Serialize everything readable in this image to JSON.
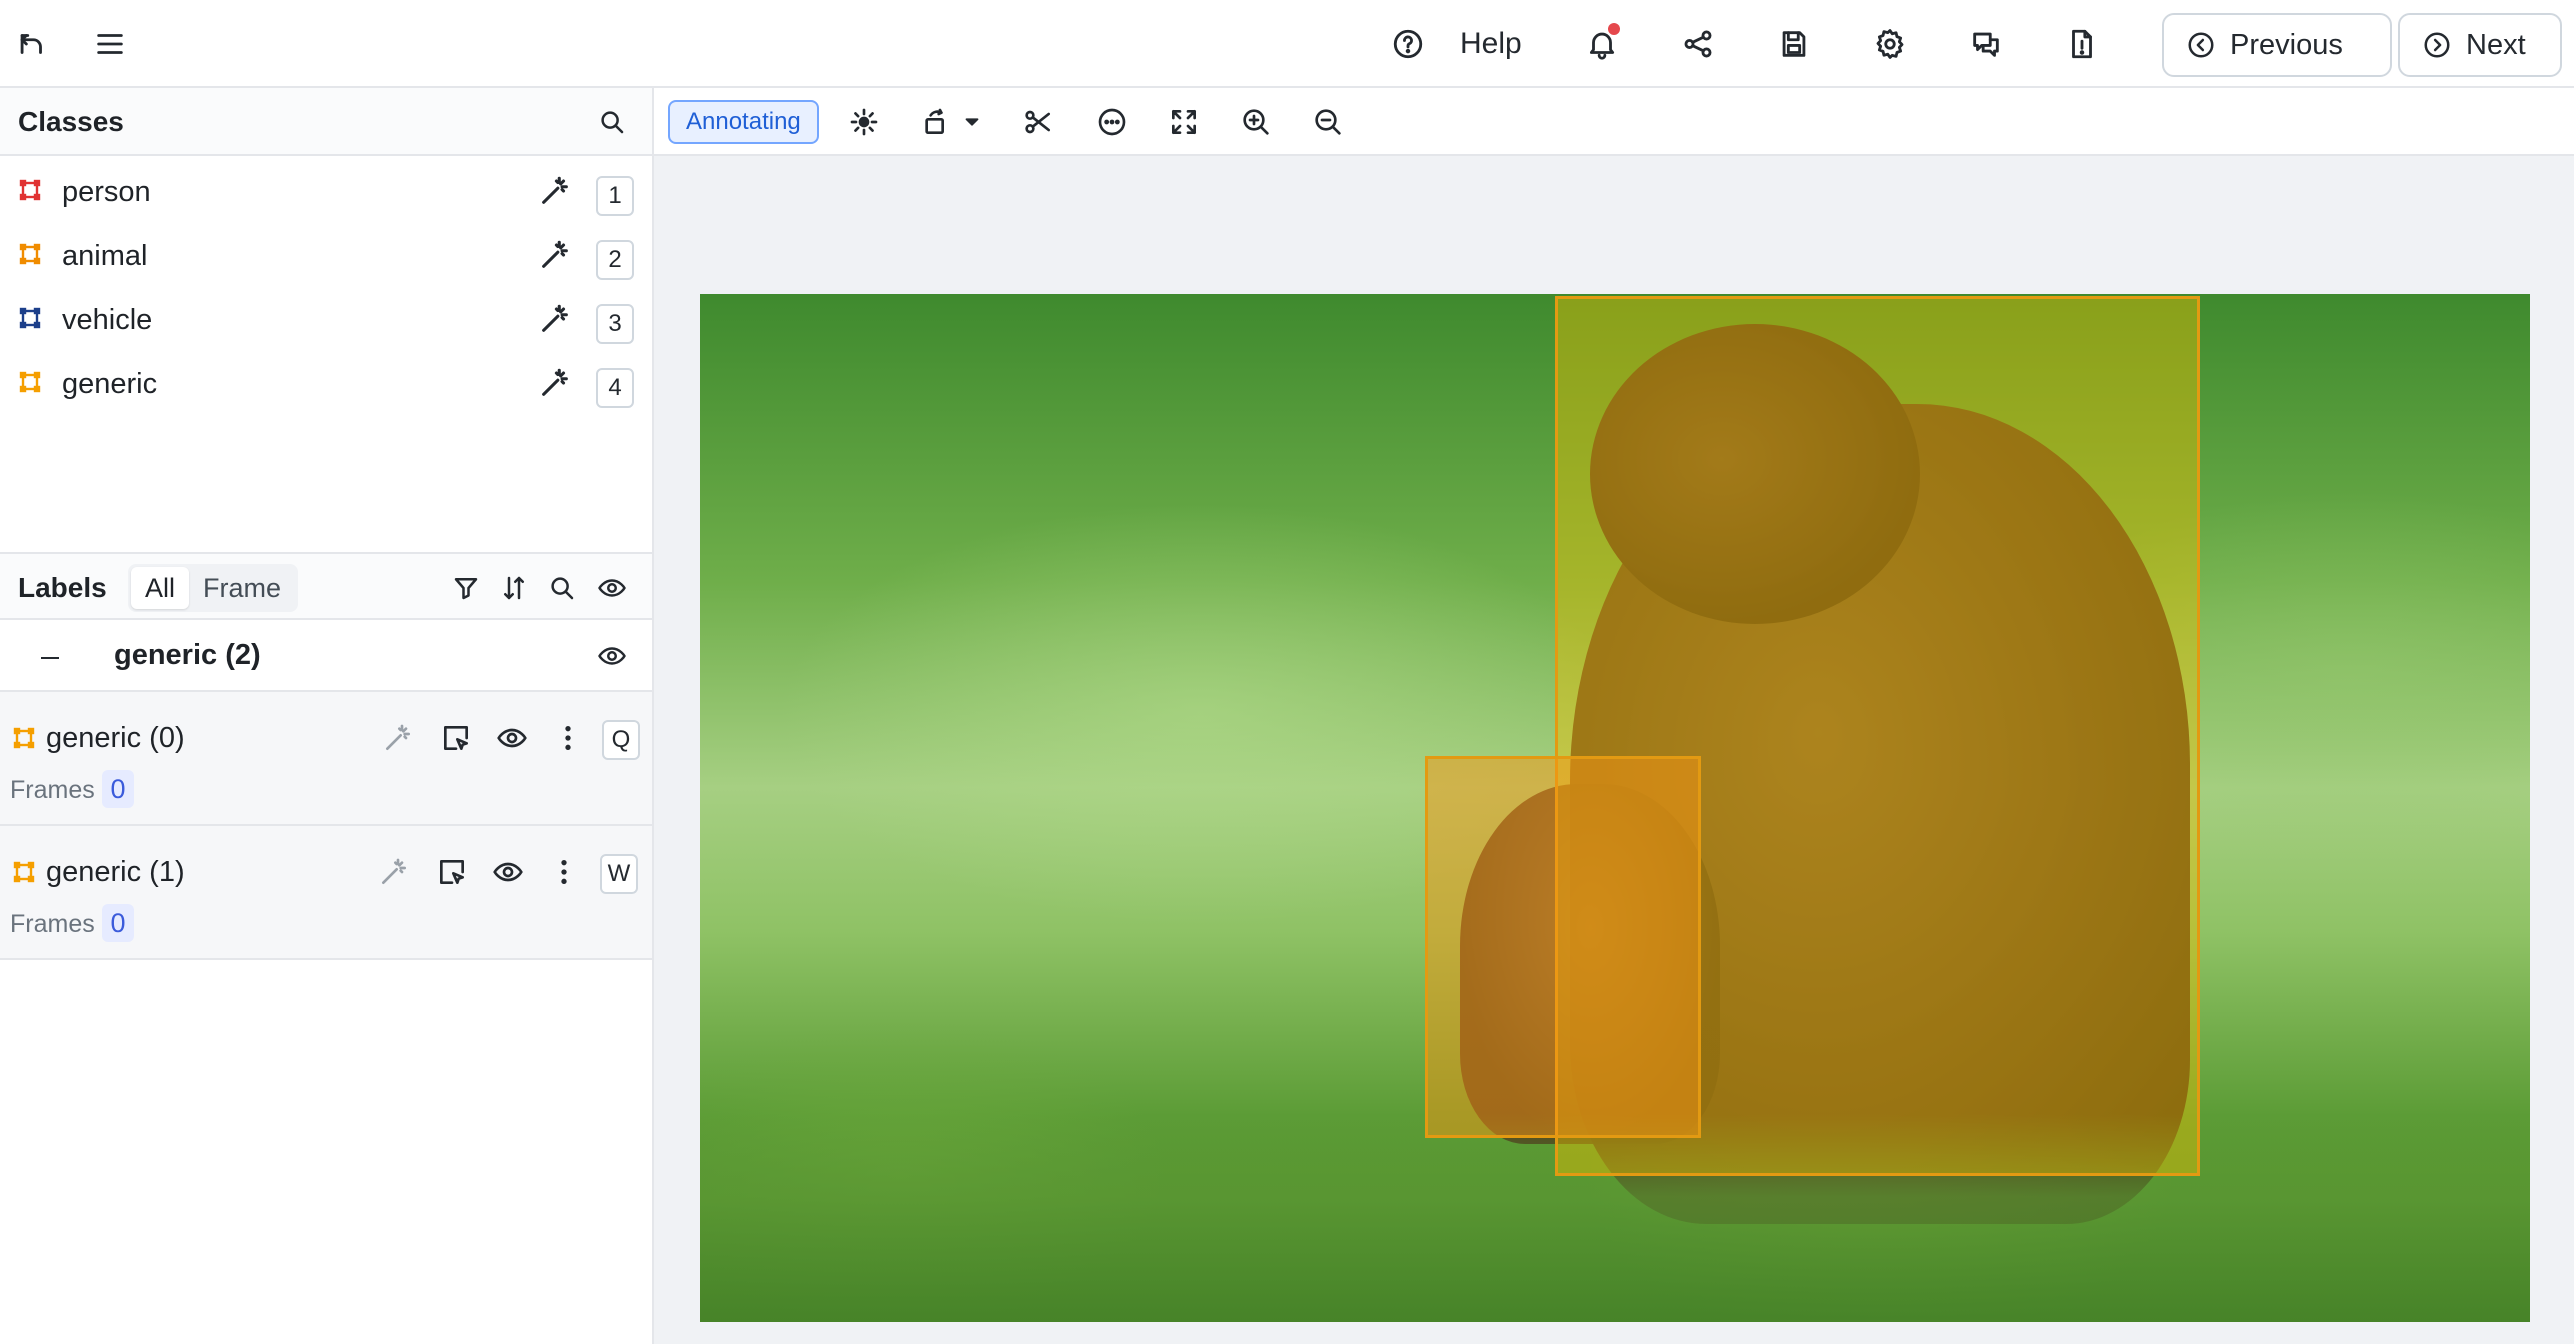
{
  "topbar": {
    "help_label": "Help",
    "previous_label": "Previous",
    "next_label": "Next",
    "notification_dot_color": "#e5484d"
  },
  "classes_panel": {
    "title": "Classes",
    "items": [
      {
        "label": "person",
        "key": "1",
        "color": "#e03131"
      },
      {
        "label": "animal",
        "key": "2",
        "color": "#f08c00"
      },
      {
        "label": "vehicle",
        "key": "3",
        "color": "#1c3f8a"
      },
      {
        "label": "generic",
        "key": "4",
        "color": "#f59f00"
      }
    ]
  },
  "labels_panel": {
    "title": "Labels",
    "tabs": [
      "All",
      "Frame"
    ],
    "active_tab": "All",
    "group": {
      "label": "generic (2)"
    },
    "items": [
      {
        "name": "generic (0)",
        "key": "Q",
        "frames_label": "Frames",
        "frames_value": "0"
      },
      {
        "name": "generic (1)",
        "key": "W",
        "frames_label": "Frames",
        "frames_value": "0"
      }
    ]
  },
  "toolbar": {
    "mode_label": "Annotating"
  },
  "canvas": {
    "box_color": "#e39a12"
  }
}
